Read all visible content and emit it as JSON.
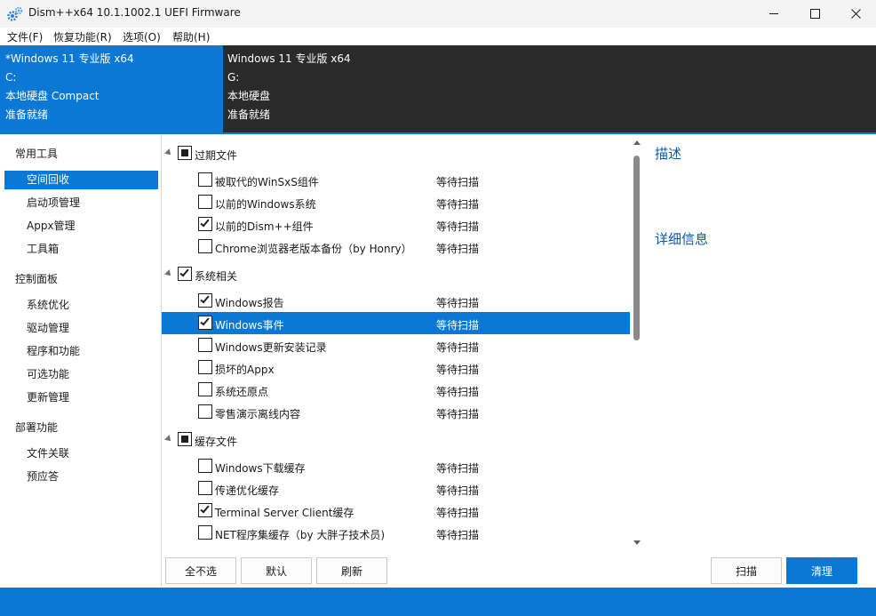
{
  "window": {
    "title": "Dism++x64 10.1.1002.1 UEFI Firmware"
  },
  "menu": [
    "文件(F)",
    "恢复功能(R)",
    "选项(O)",
    "帮助(H)"
  ],
  "sessions": [
    {
      "lines": [
        "*Windows 11 专业版 x64",
        "C:",
        "本地硬盘 Compact",
        "准备就绪"
      ],
      "active": true
    },
    {
      "lines": [
        "Windows 11 专业版 x64",
        "G:",
        "本地硬盘",
        "准备就绪"
      ],
      "active": false
    }
  ],
  "sidebar": {
    "groups": [
      {
        "label": "常用工具",
        "items": [
          "空间回收",
          "启动项管理",
          "Appx管理",
          "工具箱"
        ]
      },
      {
        "label": "控制面板",
        "items": [
          "系统优化",
          "驱动管理",
          "程序和功能",
          "可选功能",
          "更新管理"
        ]
      },
      {
        "label": "部署功能",
        "items": [
          "文件关联",
          "预应答"
        ]
      }
    ],
    "active_item": "空间回收"
  },
  "cleanup": {
    "groups": [
      {
        "label": "过期文件",
        "state": "partial",
        "items": [
          {
            "label": "被取代的WinSxS组件",
            "checked": false,
            "status": "等待扫描"
          },
          {
            "label": "以前的Windows系统",
            "checked": false,
            "status": "等待扫描"
          },
          {
            "label": "以前的Dism++组件",
            "checked": true,
            "status": "等待扫描"
          },
          {
            "label": "Chrome浏览器老版本备份（by Honry）",
            "checked": false,
            "status": "等待扫描"
          }
        ]
      },
      {
        "label": "系统相关",
        "state": "checked",
        "items": [
          {
            "label": "Windows报告",
            "checked": true,
            "status": "等待扫描"
          },
          {
            "label": "Windows事件",
            "checked": true,
            "status": "等待扫描",
            "selected": true
          },
          {
            "label": "Windows更新安装记录",
            "checked": false,
            "status": "等待扫描"
          },
          {
            "label": "损坏的Appx",
            "checked": false,
            "status": "等待扫描"
          },
          {
            "label": "系统还原点",
            "checked": false,
            "status": "等待扫描"
          },
          {
            "label": "零售演示离线内容",
            "checked": false,
            "status": "等待扫描"
          }
        ]
      },
      {
        "label": "缓存文件",
        "state": "partial",
        "items": [
          {
            "label": "Windows下载缓存",
            "checked": false,
            "status": "等待扫描"
          },
          {
            "label": "传递优化缓存",
            "checked": false,
            "status": "等待扫描"
          },
          {
            "label": "Terminal Server Client缓存",
            "checked": true,
            "status": "等待扫描"
          },
          {
            "label": "NET程序集缓存（by 大胖子技术员)",
            "checked": false,
            "status": "等待扫描"
          }
        ]
      }
    ]
  },
  "buttons": {
    "deselect_all": "全不选",
    "default": "默认",
    "refresh": "刷新",
    "scan": "扫描",
    "clean": "清理"
  },
  "description": {
    "heading": "描述",
    "details_heading": "详细信息"
  }
}
